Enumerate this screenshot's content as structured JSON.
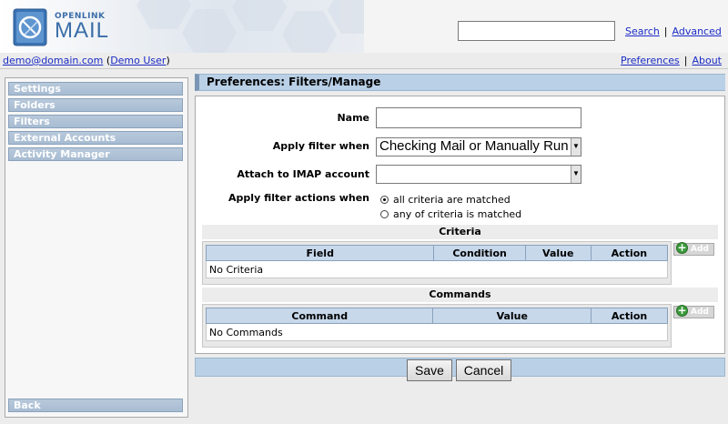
{
  "logo": {
    "small": "OPENLINK",
    "big": "MAIL"
  },
  "header": {
    "search_value": "",
    "search_label": "Search",
    "advanced_label": "Advanced",
    "separator": "|"
  },
  "userbar": {
    "email": "demo@domain.com",
    "user_name": "Demo User",
    "preferences_label": "Preferences",
    "about_label": "About"
  },
  "sidebar": {
    "items": [
      {
        "label": "Settings"
      },
      {
        "label": "Folders"
      },
      {
        "label": "Filters"
      },
      {
        "label": "External Accounts"
      },
      {
        "label": "Activity Manager"
      }
    ],
    "back_label": "Back"
  },
  "main": {
    "title": "Preferences: Filters/Manage",
    "form": {
      "name_label": "Name",
      "name_value": "",
      "apply_when_label": "Apply filter when",
      "apply_when_value": "Checking Mail or Manually Run",
      "imap_label": "Attach to IMAP account",
      "imap_value": "",
      "actions_when_label": "Apply filter actions when",
      "radio_all": "all criteria are matched",
      "radio_any": "any of criteria is matched",
      "selected_radio": "all"
    },
    "criteria": {
      "heading": "Criteria",
      "columns": [
        "Field",
        "Condition",
        "Value",
        "Action"
      ],
      "empty_text": "No Criteria",
      "add_label": "Add"
    },
    "commands": {
      "heading": "Commands",
      "columns": [
        "Command",
        "Value",
        "Action"
      ],
      "empty_text": "No Commands",
      "add_label": "Add"
    },
    "buttons": {
      "save": "Save",
      "cancel": "Cancel"
    }
  },
  "colors": {
    "link": "#1a2bc4",
    "sidebar_item": "#a7bcd2",
    "title_bar": "#b9d0e6",
    "add_icon": "#3a9a3a"
  }
}
